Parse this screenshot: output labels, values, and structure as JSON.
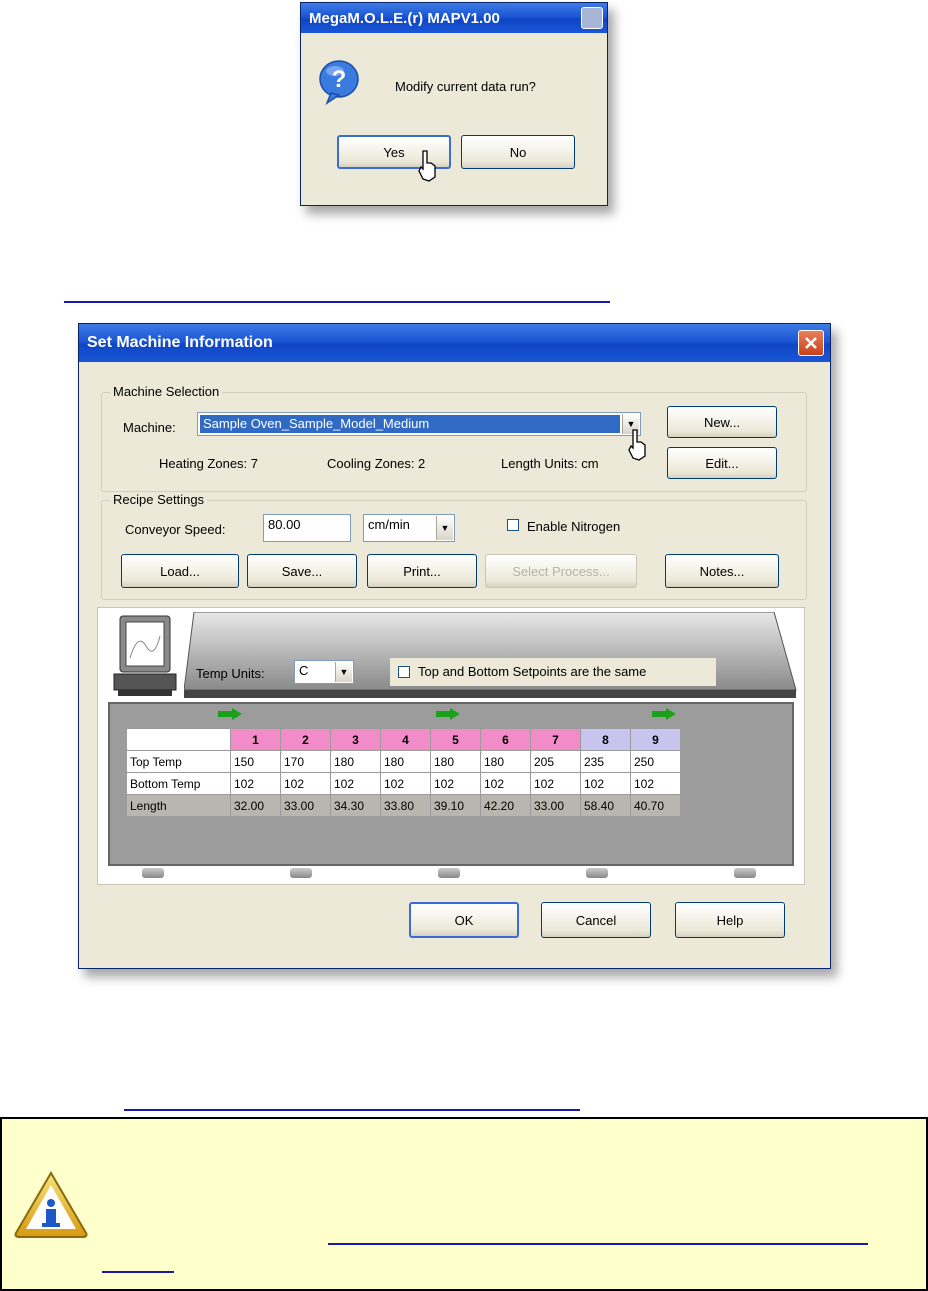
{
  "confirm_dialog": {
    "title": "MegaM.O.L.E.(r) MAPV1.00",
    "message": "Modify current data run?",
    "yes_label": "Yes",
    "no_label": "No"
  },
  "set_machine_dialog": {
    "title": "Set Machine Information",
    "machine_selection": {
      "group_label": "Machine Selection",
      "machine_label": "Machine:",
      "machine_value": "Sample Oven_Sample_Model_Medium",
      "new_label": "New...",
      "edit_label": "Edit...",
      "heating_zones": "Heating Zones: 7",
      "cooling_zones": "Cooling Zones: 2",
      "length_units": "Length Units: cm"
    },
    "recipe_settings": {
      "group_label": "Recipe Settings",
      "conveyor_label": "Conveyor Speed:",
      "conveyor_value": "80.00",
      "speed_units": "cm/min",
      "nitrogen_label": "Enable Nitrogen",
      "load_label": "Load...",
      "save_label": "Save...",
      "print_label": "Print...",
      "disabled_label": "Select Process...",
      "notes_label": "Notes..."
    },
    "oven": {
      "temp_units_label": "Temp Units:",
      "temp_units_value": "C",
      "same_setpoints_label": "Top and Bottom Setpoints are the same",
      "zones": [
        "1",
        "2",
        "3",
        "4",
        "5",
        "6",
        "7",
        "8",
        "9"
      ],
      "zone_types": [
        "heat",
        "heat",
        "heat",
        "heat",
        "heat",
        "heat",
        "heat",
        "cool",
        "cool"
      ],
      "rows": [
        {
          "label": "Top Temp",
          "values": [
            "150",
            "170",
            "180",
            "180",
            "180",
            "180",
            "205",
            "235",
            "250"
          ]
        },
        {
          "label": "Bottom Temp",
          "values": [
            "102",
            "102",
            "102",
            "102",
            "102",
            "102",
            "102",
            "102",
            "102"
          ]
        },
        {
          "label": "Length",
          "values": [
            "32.00",
            "33.00",
            "34.30",
            "33.80",
            "39.10",
            "42.20",
            "33.00",
            "58.40",
            "40.70"
          ]
        }
      ]
    },
    "ok_label": "OK",
    "cancel_label": "Cancel",
    "help_label": "Help"
  },
  "colors": {
    "title_bar": "#1c56d4",
    "dialog_bg": "#ece9d8",
    "heating_zone": "#f28cc8",
    "cooling_zone": "#c8c4ee",
    "note_bg": "#ffffcc",
    "link": "#1a1aa8"
  }
}
